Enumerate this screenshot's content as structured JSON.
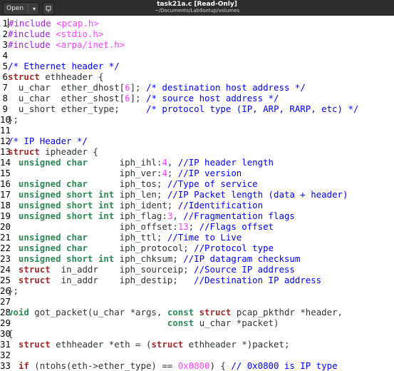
{
  "window": {
    "open_label": "Open",
    "title": "task21a.c [Read-Only]",
    "subtitle": "~/Documents/Lab9setup/volumes",
    "icons": [
      "chevron-down-icon",
      "pin-icon"
    ]
  },
  "editor": {
    "token_colors": {
      "pp": "#a020f0",
      "str": "#ff00ff",
      "cm": "#0000ff",
      "kw": "#a52a2a",
      "ty": "#2e8b57",
      "num": "#ff00ff",
      "tx": "#2e3436"
    },
    "lines": [
      {
        "n": "1",
        "t": [
          [
            "pp",
            "#include "
          ],
          [
            "str",
            "<pcap.h>"
          ]
        ]
      },
      {
        "n": "2",
        "t": [
          [
            "pp",
            "#include "
          ],
          [
            "str",
            "<stdio.h>"
          ]
        ]
      },
      {
        "n": "3",
        "t": [
          [
            "pp",
            "#include "
          ],
          [
            "str",
            "<arpa/inet.h>"
          ]
        ]
      },
      {
        "n": "4",
        "t": []
      },
      {
        "n": "5",
        "t": [
          [
            "cm",
            "/* Ethernet header */"
          ]
        ]
      },
      {
        "n": "6",
        "t": [
          [
            "kw",
            "struct"
          ],
          [
            "tx",
            " ethheader {"
          ]
        ]
      },
      {
        "n": "7",
        "t": [
          [
            "tx",
            "  u_char  ether_dhost["
          ],
          [
            "num",
            "6"
          ],
          [
            "tx",
            "]; "
          ],
          [
            "cm",
            "/* destination host address */"
          ]
        ]
      },
      {
        "n": "8",
        "t": [
          [
            "tx",
            "  u_char  ether_shost["
          ],
          [
            "num",
            "6"
          ],
          [
            "tx",
            "]; "
          ],
          [
            "cm",
            "/* source host address */"
          ]
        ]
      },
      {
        "n": "9",
        "t": [
          [
            "tx",
            "  u_short ether_type;     "
          ],
          [
            "cm",
            "/* protocol type (IP, ARP, RARP, etc) */"
          ]
        ]
      },
      {
        "n": "10",
        "t": [
          [
            "tx",
            "};"
          ]
        ]
      },
      {
        "n": "11",
        "t": []
      },
      {
        "n": "12",
        "t": [
          [
            "cm",
            "/* IP Header */"
          ]
        ]
      },
      {
        "n": "13",
        "t": [
          [
            "kw",
            "struct"
          ],
          [
            "tx",
            " ipheader {"
          ]
        ]
      },
      {
        "n": "14",
        "t": [
          [
            "tx",
            "  "
          ],
          [
            "ty",
            "unsigned char"
          ],
          [
            "tx",
            "      iph_ihl:"
          ],
          [
            "num",
            "4"
          ],
          [
            "tx",
            ", "
          ],
          [
            "cm",
            "//IP header length"
          ]
        ]
      },
      {
        "n": "15",
        "t": [
          [
            "tx",
            "                     iph_ver:"
          ],
          [
            "num",
            "4"
          ],
          [
            "tx",
            "; "
          ],
          [
            "cm",
            "//IP version"
          ]
        ]
      },
      {
        "n": "16",
        "t": [
          [
            "tx",
            "  "
          ],
          [
            "ty",
            "unsigned char"
          ],
          [
            "tx",
            "      iph_tos; "
          ],
          [
            "cm",
            "//Type of service"
          ]
        ]
      },
      {
        "n": "17",
        "t": [
          [
            "tx",
            "  "
          ],
          [
            "ty",
            "unsigned short int"
          ],
          [
            "tx",
            " iph_len; "
          ],
          [
            "cm",
            "//IP Packet length (data + header)"
          ]
        ]
      },
      {
        "n": "18",
        "t": [
          [
            "tx",
            "  "
          ],
          [
            "ty",
            "unsigned short int"
          ],
          [
            "tx",
            " iph_ident; "
          ],
          [
            "cm",
            "//Identification"
          ]
        ]
      },
      {
        "n": "19",
        "t": [
          [
            "tx",
            "  "
          ],
          [
            "ty",
            "unsigned short int"
          ],
          [
            "tx",
            " iph_flag:"
          ],
          [
            "num",
            "3"
          ],
          [
            "tx",
            ", "
          ],
          [
            "cm",
            "//Fragmentation flags"
          ]
        ]
      },
      {
        "n": "20",
        "t": [
          [
            "tx",
            "                     iph_offset:"
          ],
          [
            "num",
            "13"
          ],
          [
            "tx",
            "; "
          ],
          [
            "cm",
            "//Flags offset"
          ]
        ]
      },
      {
        "n": "21",
        "t": [
          [
            "tx",
            "  "
          ],
          [
            "ty",
            "unsigned char"
          ],
          [
            "tx",
            "      iph_ttl; "
          ],
          [
            "cm",
            "//Time to Live"
          ]
        ]
      },
      {
        "n": "22",
        "t": [
          [
            "tx",
            "  "
          ],
          [
            "ty",
            "unsigned char"
          ],
          [
            "tx",
            "      iph_protocol; "
          ],
          [
            "cm",
            "//Protocol type"
          ]
        ]
      },
      {
        "n": "23",
        "t": [
          [
            "tx",
            "  "
          ],
          [
            "ty",
            "unsigned short int"
          ],
          [
            "tx",
            " iph_chksum; "
          ],
          [
            "cm",
            "//IP datagram checksum"
          ]
        ]
      },
      {
        "n": "24",
        "t": [
          [
            "tx",
            "  "
          ],
          [
            "kw",
            "struct"
          ],
          [
            "tx",
            "  in_addr    iph_sourceip; "
          ],
          [
            "cm",
            "//Source IP address"
          ]
        ]
      },
      {
        "n": "25",
        "t": [
          [
            "tx",
            "  "
          ],
          [
            "kw",
            "struct"
          ],
          [
            "tx",
            "  in_addr    iph_destip;   "
          ],
          [
            "cm",
            "//Destination IP address"
          ]
        ]
      },
      {
        "n": "26",
        "t": [
          [
            "tx",
            "};"
          ]
        ]
      },
      {
        "n": "27",
        "t": []
      },
      {
        "n": "28",
        "t": [
          [
            "ty",
            "void"
          ],
          [
            "tx",
            " got_packet(u_char *args, "
          ],
          [
            "ty",
            "const"
          ],
          [
            "tx",
            " "
          ],
          [
            "kw",
            "struct"
          ],
          [
            "tx",
            " pcap_pkthdr *header,"
          ]
        ]
      },
      {
        "n": "29",
        "t": [
          [
            "tx",
            "                              "
          ],
          [
            "ty",
            "const"
          ],
          [
            "tx",
            " u_char *packet)"
          ]
        ]
      },
      {
        "n": "30",
        "t": [
          [
            "tx",
            "{"
          ]
        ]
      },
      {
        "n": "31",
        "t": [
          [
            "tx",
            "  "
          ],
          [
            "kw",
            "struct"
          ],
          [
            "tx",
            " ethheader *eth = ("
          ],
          [
            "kw",
            "struct"
          ],
          [
            "tx",
            " ethheader *)packet;"
          ]
        ]
      },
      {
        "n": "32",
        "t": []
      },
      {
        "n": "33",
        "t": [
          [
            "tx",
            "  "
          ],
          [
            "kw",
            "if"
          ],
          [
            "tx",
            " (ntohs(eth->ether_type) == "
          ],
          [
            "num",
            "0x0800"
          ],
          [
            "tx",
            ") { "
          ],
          [
            "cm",
            "// 0x0800 is IP type"
          ]
        ]
      }
    ]
  }
}
